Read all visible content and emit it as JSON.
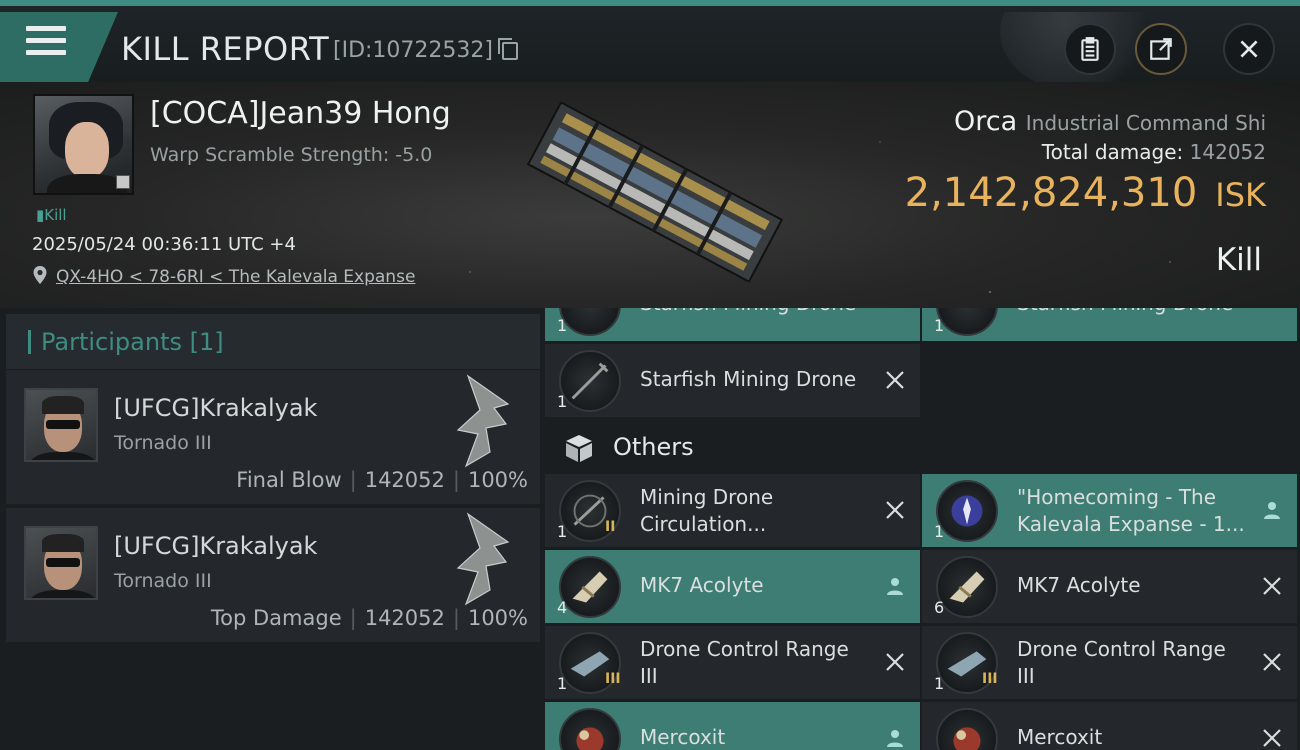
{
  "window": {
    "title": "KILL REPORT",
    "id_label": "[ID:10722532]"
  },
  "victim": {
    "name": "[COCA]Jean39 Hong",
    "warp_scramble": "Warp Scramble Strength: -5.0",
    "tag": "Kill",
    "datetime": "2025/05/24 00:36:11 UTC +4",
    "location": "QX-4HO < 78-6RI < The Kalevala Expanse",
    "ship_name": "Orca",
    "ship_class": "Industrial Command Shi",
    "total_damage_label": "Total damage:",
    "total_damage": "142052",
    "isk_value": "2,142,824,310",
    "isk_currency": "ISK",
    "result": "Kill"
  },
  "participants": {
    "header": "Participants",
    "count": "[1]",
    "list": [
      {
        "name": "[UFCG]Krakalyak",
        "ship": "Tornado III",
        "role": "Final Blow",
        "damage": "142052",
        "percent": "100%"
      },
      {
        "name": "[UFCG]Krakalyak",
        "ship": "Tornado III",
        "role": "Top Damage",
        "damage": "142052",
        "percent": "100%"
      }
    ]
  },
  "items": {
    "top_partial": [
      {
        "name": "Starfish Mining Drone",
        "qty": "1",
        "status": "destroyed"
      },
      {
        "name": "Starfish Mining Drone",
        "qty": "1",
        "status": "destroyed"
      }
    ],
    "drones": [
      {
        "name": "Starfish Mining Drone",
        "qty": "1",
        "status": "destroyed"
      }
    ],
    "others_label": "Others",
    "others": [
      {
        "name": "Mining Drone Circulation...",
        "qty": "1",
        "tier": "II",
        "status": "destroyed"
      },
      {
        "name": "\"Homecoming - The Kalevala Expanse - 1...",
        "qty": "1",
        "tier": "",
        "status": "dropped"
      },
      {
        "name": "MK7 Acolyte",
        "qty": "4",
        "tier": "",
        "status": "dropped"
      },
      {
        "name": "MK7 Acolyte",
        "qty": "6",
        "tier": "",
        "status": "destroyed"
      },
      {
        "name": "Drone Control Range III",
        "qty": "1",
        "tier": "III",
        "status": "destroyed"
      },
      {
        "name": "Drone Control Range III",
        "qty": "1",
        "tier": "III",
        "status": "destroyed"
      },
      {
        "name": "Mercoxit",
        "qty": "",
        "tier": "",
        "status": "dropped"
      },
      {
        "name": "Mercoxit",
        "qty": "",
        "tier": "",
        "status": "destroyed"
      }
    ]
  },
  "colors": {
    "accent": "#3f8c82",
    "isk": "#e9b35d",
    "dropped_bg": "#3e7d74",
    "destroyed_bg": "#24282c"
  },
  "icons": [
    "menu-icon",
    "copy-icon",
    "clipboard-icon",
    "share-icon",
    "close-icon",
    "location-pin-icon",
    "cube-icon",
    "person-icon",
    "x-icon"
  ]
}
